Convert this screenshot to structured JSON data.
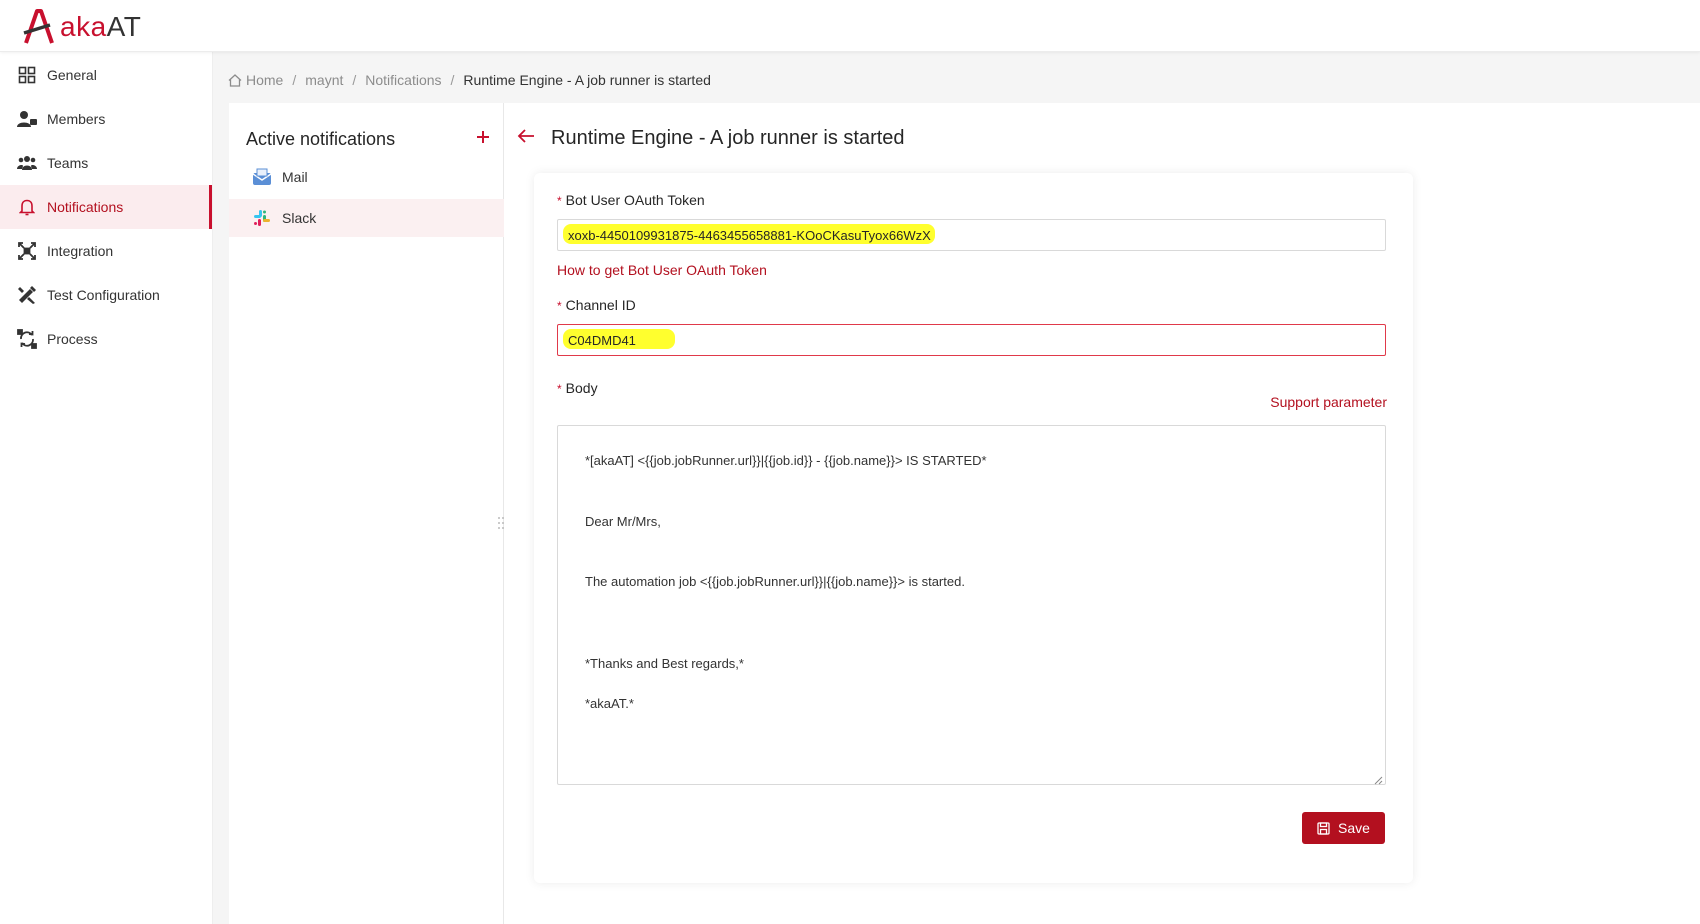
{
  "app": {
    "logo_text_a": "aka",
    "logo_text_b": "AT"
  },
  "sidebar": {
    "items": [
      {
        "label": "General",
        "icon": "grid-icon"
      },
      {
        "label": "Members",
        "icon": "members-icon"
      },
      {
        "label": "Teams",
        "icon": "teams-icon"
      },
      {
        "label": "Notifications",
        "icon": "bell-icon",
        "active": true
      },
      {
        "label": "Integration",
        "icon": "integration-icon"
      },
      {
        "label": "Test Configuration",
        "icon": "tools-icon"
      },
      {
        "label": "Process",
        "icon": "process-icon"
      }
    ]
  },
  "breadcrumb": {
    "home": "Home",
    "project": "maynt",
    "section": "Notifications",
    "current": "Runtime Engine - A job runner is started"
  },
  "notifications": {
    "title": "Active notifications",
    "channels": [
      {
        "label": "Mail",
        "icon": "mail-icon"
      },
      {
        "label": "Slack",
        "icon": "slack-icon",
        "active": true
      }
    ]
  },
  "detail": {
    "title": "Runtime Engine - A job runner is started",
    "token_label": "Bot User OAuth Token",
    "token_value": "xoxb-4450109931875-4463455658881-KOoCKasuTyox66WzX",
    "token_help": "How to get Bot User OAuth Token",
    "channel_label": "Channel ID",
    "channel_value": "C04DMD41",
    "body_label": "Body",
    "support_link": "Support parameter",
    "body_lines": [
      "*[akaAT] <{{job.jobRunner.url}}|{{job.id}} - {{job.name}}> IS STARTED*",
      "Dear Mr/Mrs,",
      "The automation job <{{job.jobRunner.url}}|{{job.name}}> is started.",
      "*Thanks and Best regards,*",
      "*akaAT.*"
    ],
    "save_label": "Save"
  },
  "colors": {
    "brand": "#c8102e",
    "brand_dark": "#b3101f",
    "highlight": "#ffff2e"
  }
}
